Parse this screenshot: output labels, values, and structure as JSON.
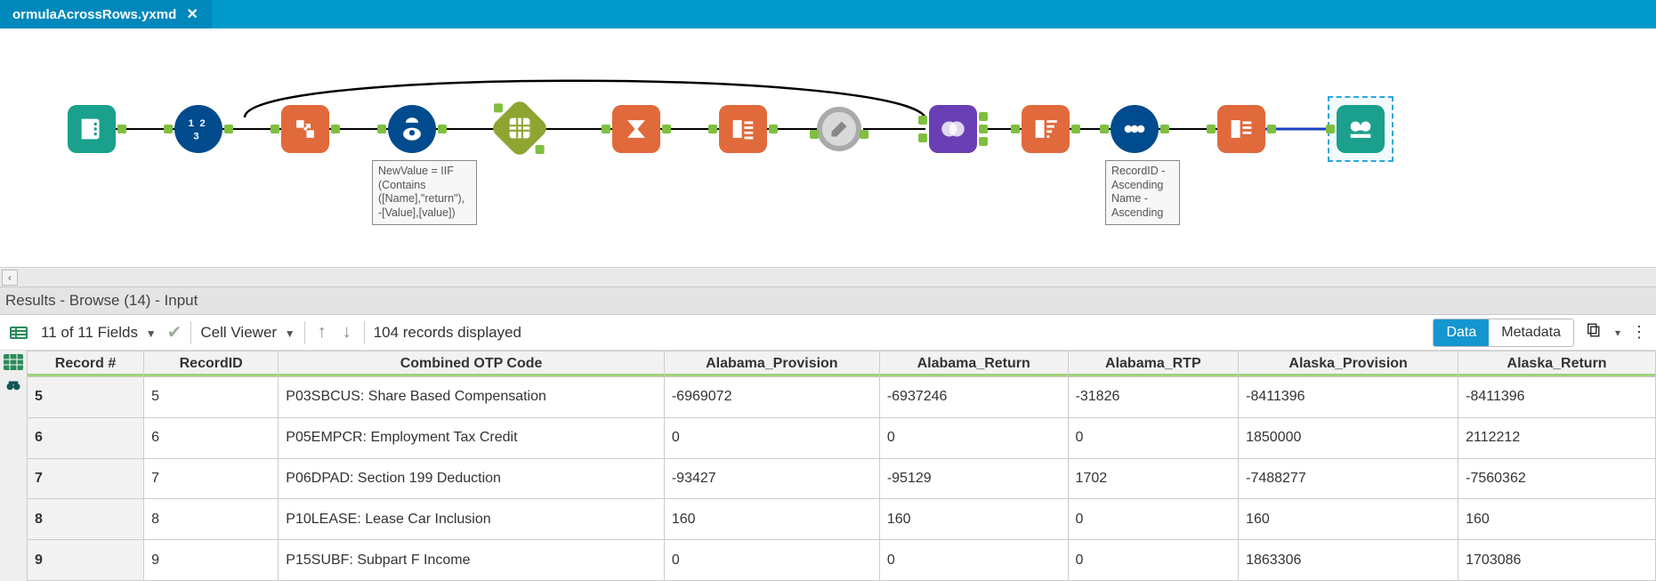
{
  "tab": {
    "title": "ormulaAcrossRows.yxmd"
  },
  "annotations": {
    "formula": "NewValue = IIF\n(Contains\n([Name],\"return\"),\n-[Value],[value])",
    "sort": "RecordID -\nAscending\nName -\nAscending"
  },
  "tools": {
    "t1": {
      "name": "input-data-tool"
    },
    "t2": {
      "name": "record-id-tool"
    },
    "t3": {
      "name": "transpose-tool"
    },
    "t4": {
      "name": "formula-tool"
    },
    "t5": {
      "name": "crosstab-tool"
    },
    "t6": {
      "name": "summarize-tool"
    },
    "t7": {
      "name": "select-tool"
    },
    "t8": {
      "name": "data-cleansing-tool"
    },
    "t9": {
      "name": "join-tool"
    },
    "t10": {
      "name": "sort-tool"
    },
    "t11": {
      "name": "dynamic-rename-tool"
    },
    "t12": {
      "name": "select2-tool"
    },
    "t13": {
      "name": "browse-tool"
    }
  },
  "results": {
    "title": "Results - Browse (14) - Input",
    "fields_label": "11 of 11 Fields",
    "cell_viewer": "Cell Viewer",
    "records_label": "104 records displayed",
    "seg_data": "Data",
    "seg_meta": "Metadata"
  },
  "grid": {
    "headers": [
      "Record #",
      "RecordID",
      "Combined OTP Code",
      "Alabama_Provision",
      "Alabama_Return",
      "Alabama_RTP",
      "Alaska_Provision",
      "Alaska_Return"
    ],
    "rows": [
      {
        "rec": "5",
        "rid": "5",
        "code": "P03SBCUS: Share Based Compensation",
        "v": [
          "-6969072",
          "-6937246",
          "-31826",
          "-8411396",
          "-8411396"
        ]
      },
      {
        "rec": "6",
        "rid": "6",
        "code": "P05EMPCR: Employment Tax Credit",
        "v": [
          "0",
          "0",
          "0",
          "1850000",
          "2112212"
        ]
      },
      {
        "rec": "7",
        "rid": "7",
        "code": "P06DPAD: Section 199 Deduction",
        "v": [
          "-93427",
          "-95129",
          "1702",
          "-7488277",
          "-7560362"
        ]
      },
      {
        "rec": "8",
        "rid": "8",
        "code": "P10LEASE: Lease Car Inclusion",
        "v": [
          "160",
          "160",
          "0",
          "160",
          "160"
        ]
      },
      {
        "rec": "9",
        "rid": "9",
        "code": "P15SUBF: Subpart F Income",
        "v": [
          "0",
          "0",
          "0",
          "1863306",
          "1703086"
        ]
      }
    ]
  }
}
